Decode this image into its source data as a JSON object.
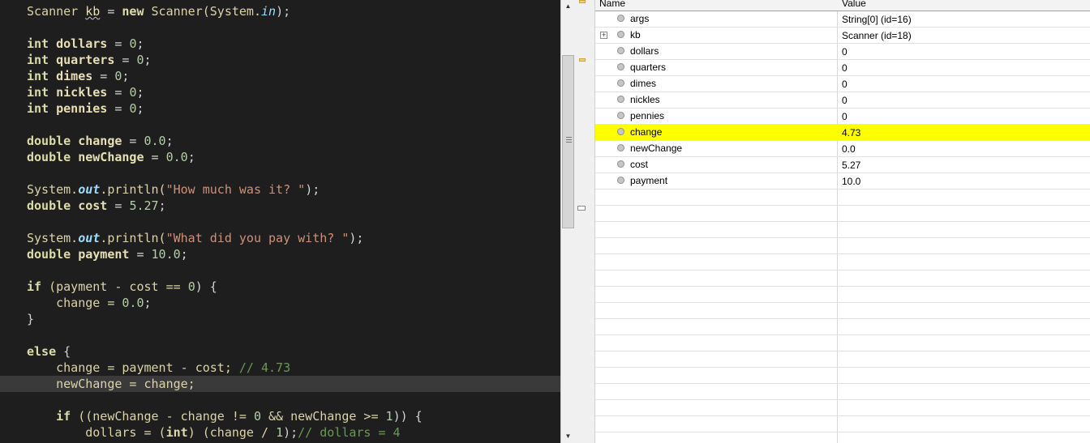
{
  "editor": {
    "lines": [
      [
        {
          "t": "Scanner ",
          "c": "cls"
        },
        {
          "t": "kb",
          "c": "id squig"
        },
        {
          "t": " = ",
          "c": "op"
        },
        {
          "t": "new ",
          "c": "kw bold"
        },
        {
          "t": "Scanner(System.",
          "c": "cls"
        },
        {
          "t": "in",
          "c": "fld"
        },
        {
          "t": ");",
          "c": "op"
        }
      ],
      [],
      [
        {
          "t": "int ",
          "c": "kw bold"
        },
        {
          "t": "dollars",
          "c": "id bold"
        },
        {
          "t": " = ",
          "c": "op"
        },
        {
          "t": "0",
          "c": "num"
        },
        {
          "t": ";",
          "c": "op"
        }
      ],
      [
        {
          "t": "int ",
          "c": "kw bold"
        },
        {
          "t": "quarters",
          "c": "id bold"
        },
        {
          "t": " = ",
          "c": "op"
        },
        {
          "t": "0",
          "c": "num"
        },
        {
          "t": ";",
          "c": "op"
        }
      ],
      [
        {
          "t": "int ",
          "c": "kw bold"
        },
        {
          "t": "dimes",
          "c": "id bold"
        },
        {
          "t": " = ",
          "c": "op"
        },
        {
          "t": "0",
          "c": "num"
        },
        {
          "t": ";",
          "c": "op"
        }
      ],
      [
        {
          "t": "int ",
          "c": "kw bold"
        },
        {
          "t": "nickles",
          "c": "id bold"
        },
        {
          "t": " = ",
          "c": "op"
        },
        {
          "t": "0",
          "c": "num"
        },
        {
          "t": ";",
          "c": "op"
        }
      ],
      [
        {
          "t": "int ",
          "c": "kw bold"
        },
        {
          "t": "pennies",
          "c": "id bold"
        },
        {
          "t": " = ",
          "c": "op"
        },
        {
          "t": "0",
          "c": "num"
        },
        {
          "t": ";",
          "c": "op"
        }
      ],
      [],
      [
        {
          "t": "double ",
          "c": "kw bold"
        },
        {
          "t": "change",
          "c": "id bold"
        },
        {
          "t": " = ",
          "c": "op"
        },
        {
          "t": "0.0",
          "c": "num"
        },
        {
          "t": ";",
          "c": "op"
        }
      ],
      [
        {
          "t": "double ",
          "c": "kw bold"
        },
        {
          "t": "newChange",
          "c": "id bold"
        },
        {
          "t": " = ",
          "c": "op"
        },
        {
          "t": "0.0",
          "c": "num"
        },
        {
          "t": ";",
          "c": "op"
        }
      ],
      [],
      [
        {
          "t": "System.",
          "c": "cls"
        },
        {
          "t": "out",
          "c": "fld bold"
        },
        {
          "t": ".println(",
          "c": "cls"
        },
        {
          "t": "\"How much was it? \"",
          "c": "str"
        },
        {
          "t": ");",
          "c": "op"
        }
      ],
      [
        {
          "t": "double ",
          "c": "kw bold"
        },
        {
          "t": "cost",
          "c": "id bold"
        },
        {
          "t": " = ",
          "c": "op"
        },
        {
          "t": "5.27",
          "c": "num"
        },
        {
          "t": ";",
          "c": "op"
        }
      ],
      [],
      [
        {
          "t": "System.",
          "c": "cls"
        },
        {
          "t": "out",
          "c": "fld bold"
        },
        {
          "t": ".println(",
          "c": "cls"
        },
        {
          "t": "\"What did you pay with? \"",
          "c": "str"
        },
        {
          "t": ");",
          "c": "op"
        }
      ],
      [
        {
          "t": "double ",
          "c": "kw bold"
        },
        {
          "t": "payment",
          "c": "id bold"
        },
        {
          "t": " = ",
          "c": "op"
        },
        {
          "t": "10.0",
          "c": "num"
        },
        {
          "t": ";",
          "c": "op"
        }
      ],
      [],
      [
        {
          "t": "if ",
          "c": "kw bold"
        },
        {
          "t": "(payment - cost == ",
          "c": "cls"
        },
        {
          "t": "0",
          "c": "num"
        },
        {
          "t": ") {",
          "c": "op"
        }
      ],
      [
        {
          "t": "    change = ",
          "c": "cls"
        },
        {
          "t": "0.0",
          "c": "num"
        },
        {
          "t": ";",
          "c": "op"
        }
      ],
      [
        {
          "t": "}",
          "c": "op"
        }
      ],
      [],
      [
        {
          "t": "else ",
          "c": "kw bold"
        },
        {
          "t": "{",
          "c": "op"
        }
      ],
      [
        {
          "t": "    change = payment - cost; ",
          "c": "cls"
        },
        {
          "t": "// 4.73",
          "c": "cm"
        }
      ],
      [
        {
          "t": "    newChange = change;",
          "c": "cls"
        }
      ],
      [],
      [
        {
          "t": "    if ",
          "c": "kw bold"
        },
        {
          "t": "((newChange - change != ",
          "c": "cls"
        },
        {
          "t": "0",
          "c": "num"
        },
        {
          "t": " && newChange >= ",
          "c": "cls"
        },
        {
          "t": "1",
          "c": "num"
        },
        {
          "t": ")) {",
          "c": "op"
        }
      ],
      [
        {
          "t": "        dollars = (",
          "c": "cls"
        },
        {
          "t": "int",
          "c": "kw bold"
        },
        {
          "t": ") (change / ",
          "c": "cls"
        },
        {
          "t": "1",
          "c": "num"
        },
        {
          "t": ");",
          "c": "op"
        },
        {
          "t": "// dollars = 4",
          "c": "cm"
        }
      ]
    ],
    "current_line": 23
  },
  "variables": {
    "header_name": "Name",
    "header_value": "Value",
    "rows": [
      {
        "name": "args",
        "value": "String[0]  (id=16)",
        "expandable": false,
        "highlight": false
      },
      {
        "name": "kb",
        "value": "Scanner  (id=18)",
        "expandable": true,
        "highlight": false
      },
      {
        "name": "dollars",
        "value": "0",
        "expandable": false,
        "highlight": false
      },
      {
        "name": "quarters",
        "value": "0",
        "expandable": false,
        "highlight": false
      },
      {
        "name": "dimes",
        "value": "0",
        "expandable": false,
        "highlight": false
      },
      {
        "name": "nickles",
        "value": "0",
        "expandable": false,
        "highlight": false
      },
      {
        "name": "pennies",
        "value": "0",
        "expandable": false,
        "highlight": false
      },
      {
        "name": "change",
        "value": "4.73",
        "expandable": false,
        "highlight": true
      },
      {
        "name": "newChange",
        "value": "0.0",
        "expandable": false,
        "highlight": false
      },
      {
        "name": "cost",
        "value": "5.27",
        "expandable": false,
        "highlight": false
      },
      {
        "name": "payment",
        "value": "10.0",
        "expandable": false,
        "highlight": false
      }
    ],
    "empty_row_count": 16,
    "highlight_color": "#ffff00"
  }
}
